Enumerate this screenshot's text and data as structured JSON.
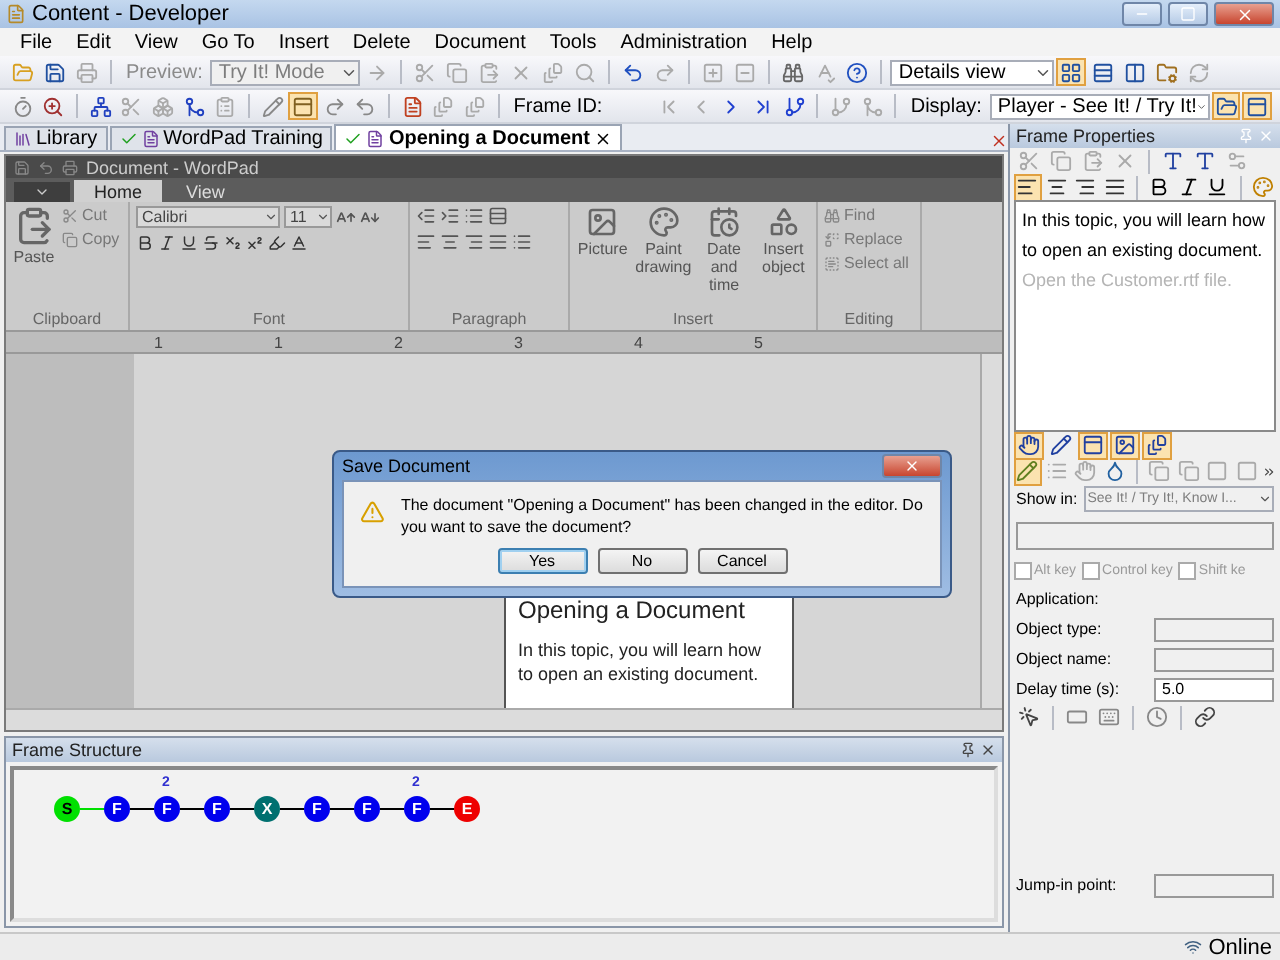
{
  "window": {
    "title": "Content - Developer"
  },
  "menu": [
    "File",
    "Edit",
    "View",
    "Go To",
    "Insert",
    "Delete",
    "Document",
    "Tools",
    "Administration",
    "Help"
  ],
  "toolbar": {
    "preview_label": "Preview:",
    "preview_mode": "Try It! Mode",
    "view_mode": "Details view",
    "frame_id_label": "Frame ID:",
    "display_label": "Display:",
    "display_mode": "Player - See It! / Try It!"
  },
  "tabs": [
    {
      "label": "Library",
      "selected": false,
      "checked": false
    },
    {
      "label": "WordPad Training",
      "selected": false,
      "checked": true
    },
    {
      "label": "Opening a Document",
      "selected": true,
      "checked": true
    }
  ],
  "wordpad": {
    "title": "Document - WordPad",
    "ribbon_tabs": [
      {
        "label": "Home",
        "selected": true
      },
      {
        "label": "View",
        "selected": false
      }
    ],
    "clipboard": {
      "paste": "Paste",
      "cut": "Cut",
      "copy": "Copy",
      "group": "Clipboard"
    },
    "font": {
      "name": "Calibri",
      "size": "11",
      "group": "Font"
    },
    "paragraph": {
      "group": "Paragraph"
    },
    "insert": {
      "buttons": [
        "Picture",
        "Paint drawing",
        "Date and time",
        "Insert object"
      ],
      "group": "Insert"
    },
    "editing": {
      "buttons": [
        "Find",
        "Replace",
        "Select all"
      ],
      "group": "Editing"
    },
    "ruler": [
      "1",
      "1",
      "2",
      "3",
      "4",
      "5"
    ],
    "page": {
      "heading": "Opening a Document",
      "body": "In this topic, you will learn how to open an existing document."
    }
  },
  "dialog": {
    "title": "Save Document",
    "message": "The document \"Opening a Document\" has been changed in the editor. Do you want to save the document?",
    "buttons": [
      {
        "label": "Yes",
        "selected": true
      },
      {
        "label": "No",
        "selected": false
      },
      {
        "label": "Cancel",
        "selected": false
      }
    ]
  },
  "frame_properties": {
    "title": "Frame Properties",
    "text": "In this topic, you will learn how to open an existing document.",
    "hint": "Open the Customer.rtf file.",
    "show_in_label": "Show in:",
    "show_in_value": "See It! / Try It!, Know I...",
    "keys": [
      {
        "label": "Alt key",
        "checked": false
      },
      {
        "label": "Control key",
        "checked": false
      },
      {
        "label": "Shift ke",
        "checked": false
      }
    ],
    "fields": [
      {
        "label": "Application:",
        "kind": "label"
      },
      {
        "label": "Object type:",
        "kind": "empty"
      },
      {
        "label": "Object name:",
        "kind": "empty"
      },
      {
        "label": "Delay time (s):",
        "kind": "value",
        "value": "5.0"
      }
    ],
    "jump_in_label": "Jump-in point:"
  },
  "frame_structure": {
    "title": "Frame Structure",
    "nodes": [
      {
        "label": "S",
        "kind": "start",
        "color": "#00e000"
      },
      {
        "label": "F",
        "kind": "frame",
        "color": "#0000ee"
      },
      {
        "label": "F",
        "kind": "frame",
        "color": "#0000ee",
        "badge": "2"
      },
      {
        "label": "F",
        "kind": "frame",
        "color": "#0000ee"
      },
      {
        "label": "X",
        "kind": "frame",
        "color": "#007070"
      },
      {
        "label": "F",
        "kind": "frame",
        "color": "#0000ee"
      },
      {
        "label": "F",
        "kind": "frame",
        "color": "#0000ee"
      },
      {
        "label": "F",
        "kind": "frame",
        "color": "#0000ee",
        "badge": "2"
      },
      {
        "label": "E",
        "kind": "end",
        "color": "#ee0000"
      }
    ]
  },
  "status_bar": {
    "status": "Online"
  }
}
